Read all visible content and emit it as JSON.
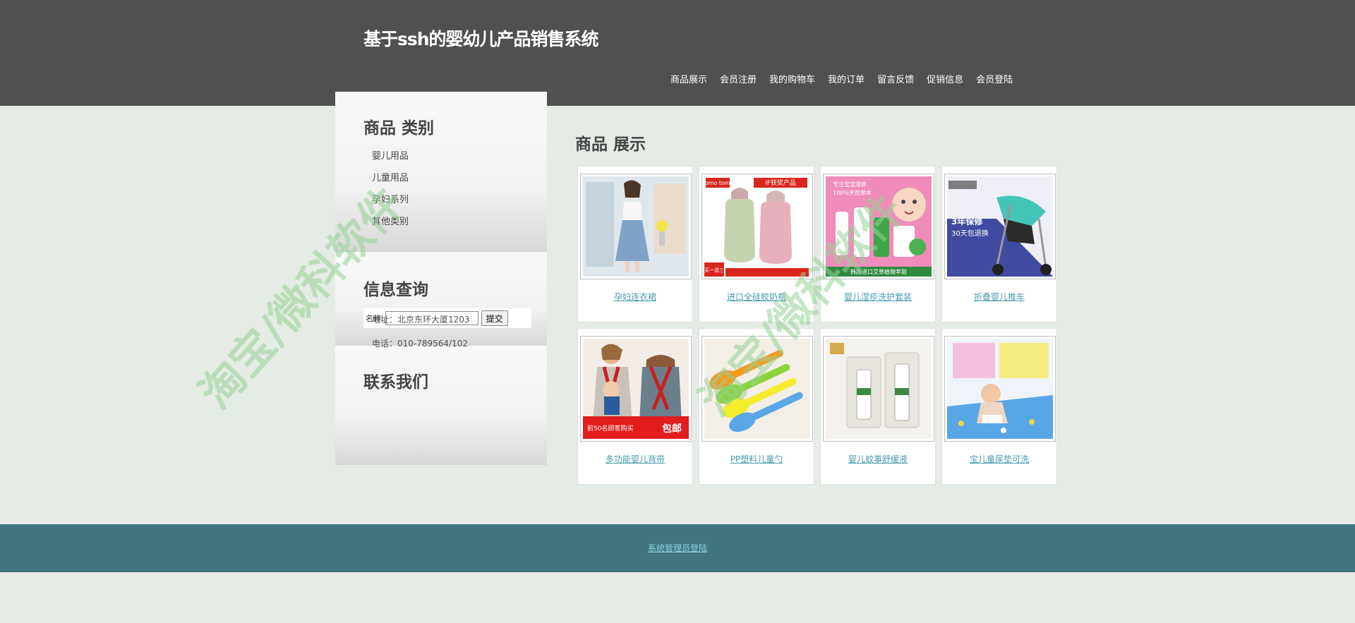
{
  "header": {
    "title": "基于ssh的婴幼儿产品销售系统",
    "nav": [
      "商品展示",
      "会员注册",
      "我的购物车",
      "我的订单",
      "留言反馈",
      "促销信息",
      "会员登陆"
    ]
  },
  "sidebar": {
    "categories": {
      "heading": "商品 类别",
      "items": [
        "婴儿用品",
        "儿童用品",
        "孕妇系列",
        "其他类别"
      ]
    },
    "search": {
      "heading": "信息查询",
      "label": "名称:",
      "input_value": "",
      "button": "提交"
    },
    "contact": {
      "heading": "联系我们",
      "address": "地址：北京东环大厦1203",
      "phone": "电话：010-789564/102"
    }
  },
  "main": {
    "heading": "商品 展示",
    "products": [
      {
        "name": "孕妇连衣裙"
      },
      {
        "name": "进口全硅胶奶瓶"
      },
      {
        "name": "婴儿湿疹洗护套装"
      },
      {
        "name": "折叠婴儿推车"
      },
      {
        "name": "多功能婴儿背带"
      },
      {
        "name": "PP塑料儿童勺"
      },
      {
        "name": "婴儿蚊事舒缓液"
      },
      {
        "name": "宝儿童尿垫可洗"
      }
    ],
    "thumb_texts": {
      "bottle_brand": "como tomo",
      "bottle_award": "IF获奖产品",
      "bottle_promo": "买一送三",
      "skincare_lines": [
        "专注宝宝湿疹",
        "100%天然草本"
      ],
      "skincare_banner": "韩国进口艾草植物萃取",
      "stroller_badge": "3年保修",
      "stroller_sub": "30天包退换",
      "carrier_banner": "前50名顾客购买",
      "carrier_tag": "包邮"
    }
  },
  "footer": {
    "admin_link": "系统管理员登陆"
  },
  "watermark": {
    "text": "淘宝/微科软件"
  },
  "colors": {
    "header_bg": "#4f5151",
    "page_bg": "#e5ebe5",
    "footer_bg": "#427482",
    "link": "#4a9bb2"
  }
}
